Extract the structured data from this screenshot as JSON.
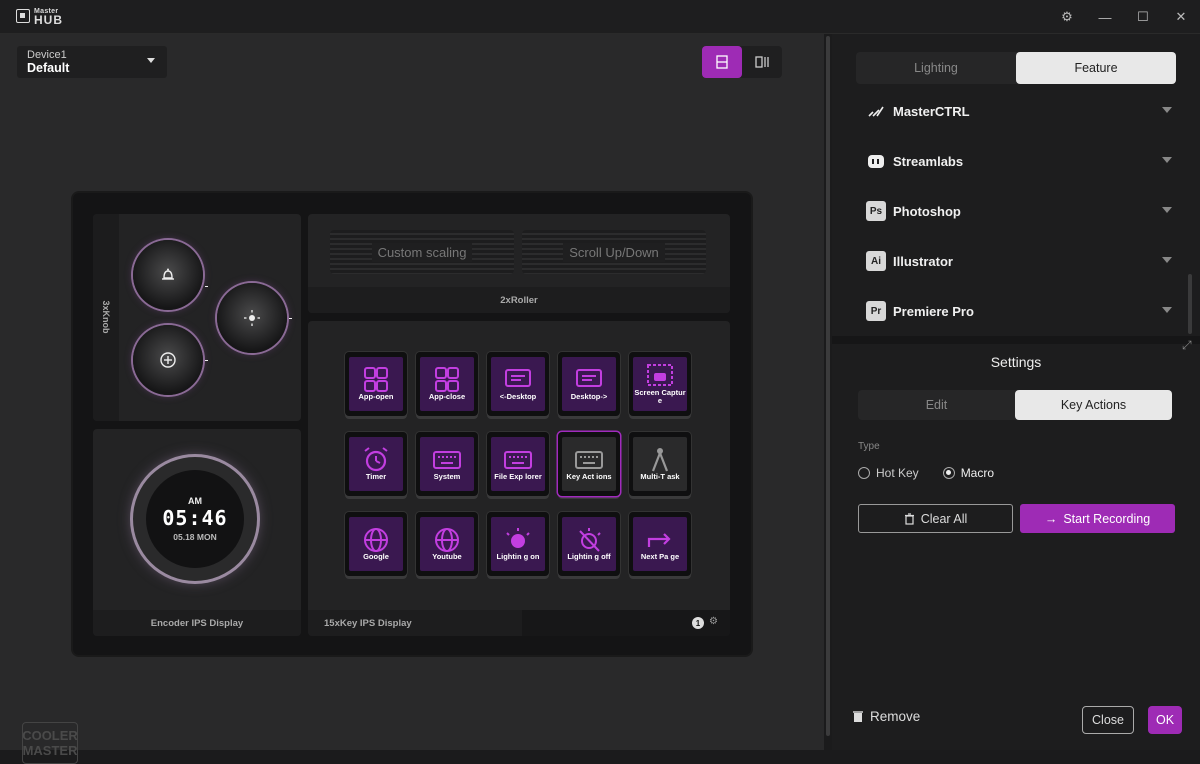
{
  "app": {
    "logo_small": "Master",
    "logo_big": "HUB"
  },
  "device_select": {
    "label": "Device1",
    "value": "Default"
  },
  "knobs": {
    "label": "3xKnob"
  },
  "rollers": {
    "left": "Custom scaling",
    "right": "Scroll Up/Down",
    "label": "2xRoller"
  },
  "encoder": {
    "ampm": "AM",
    "time": "05:46",
    "date": "05.18 MON",
    "label": "Encoder IPS Display"
  },
  "keypad": {
    "label": "15xKey IPS Display",
    "page": "1"
  },
  "keys": [
    {
      "label": "App-open",
      "icon": "grid-icon"
    },
    {
      "label": "App-close",
      "icon": "grid-icon"
    },
    {
      "label": "<-Desktop",
      "icon": "monitor-icon"
    },
    {
      "label": "Desktop->",
      "icon": "monitor-icon"
    },
    {
      "label": "Screen Capture",
      "icon": "camera-icon"
    },
    {
      "label": "Timer",
      "icon": "alarm-clock-icon"
    },
    {
      "label": "System",
      "icon": "keyboard-icon"
    },
    {
      "label": "File Exp lorer",
      "icon": "keyboard-icon"
    },
    {
      "label": "Key Act ions",
      "icon": "keyboard-icon"
    },
    {
      "label": "Multi-T ask",
      "icon": "compass-icon"
    },
    {
      "label": "Google",
      "icon": "globe-icon"
    },
    {
      "label": "Youtube",
      "icon": "globe-icon"
    },
    {
      "label": "Lightin g on",
      "icon": "bulb-icon"
    },
    {
      "label": "Lightin g off",
      "icon": "bulb-off-icon"
    },
    {
      "label": "Next Pa ge",
      "icon": "arrow-right-icon"
    }
  ],
  "brand": {
    "line1": "COOLER",
    "line2": "MASTER"
  },
  "panel_tabs": {
    "lighting": "Lighting",
    "feature": "Feature"
  },
  "apps": [
    {
      "name": "MasterCTRL",
      "icon": ""
    },
    {
      "name": "Streamlabs",
      "icon": ""
    },
    {
      "name": "Photoshop",
      "icon": "Ps"
    },
    {
      "name": "Illustrator",
      "icon": "Ai"
    },
    {
      "name": "Premiere Pro",
      "icon": "Pr"
    }
  ],
  "settings": {
    "title": "Settings",
    "tab_edit": "Edit",
    "tab_key_actions": "Key Actions",
    "type_label": "Type",
    "hot_key": "Hot Key",
    "macro": "Macro",
    "clear_all": "Clear All",
    "start_recording": "Start Recording"
  },
  "footer": {
    "remove": "Remove",
    "close": "Close",
    "ok": "OK"
  },
  "colors": {
    "accent": "#9e2bb5",
    "key_face": "#3a1850",
    "icon": "#c23ee0"
  }
}
